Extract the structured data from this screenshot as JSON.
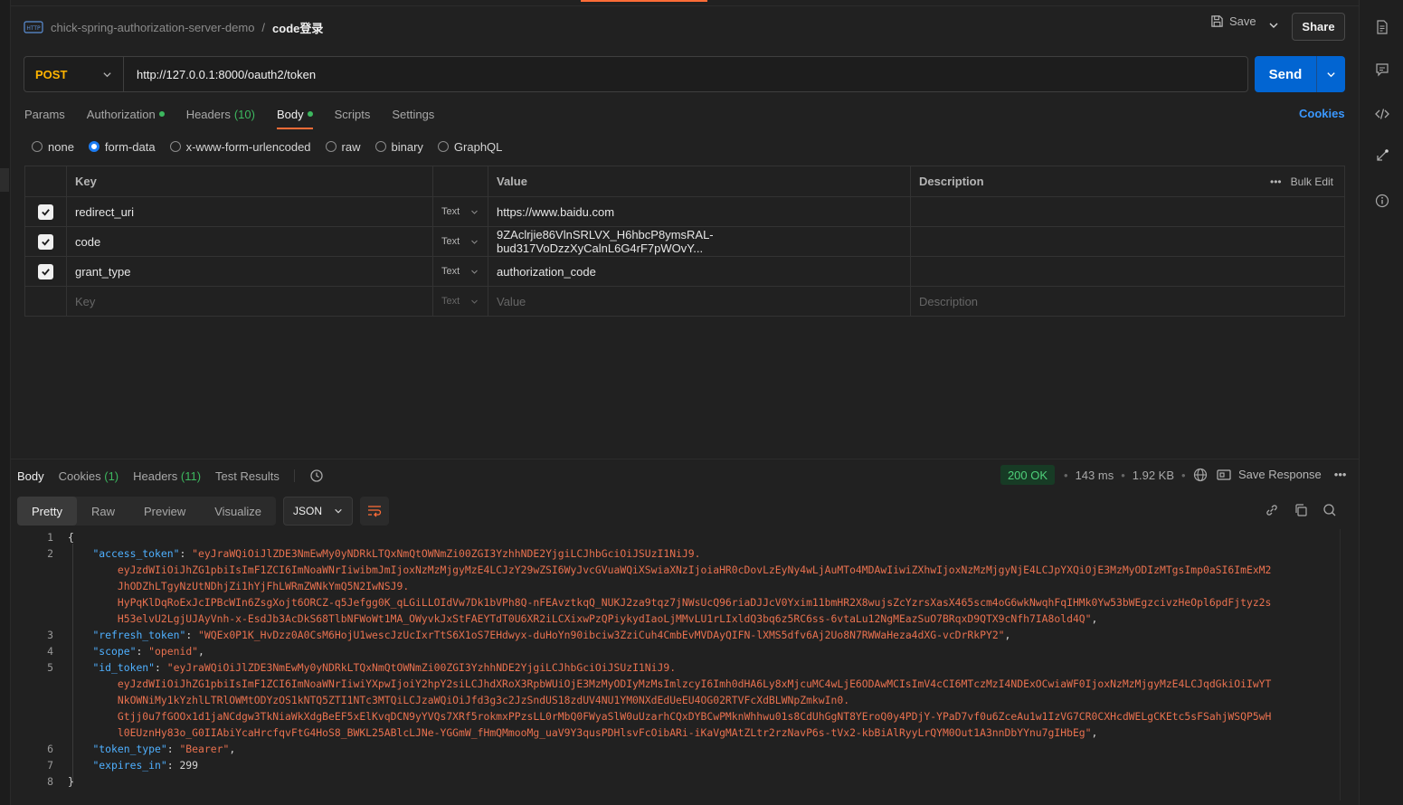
{
  "header": {
    "collection": "chick-spring-authorization-server-demo",
    "separator": "/",
    "request_name": "code登录",
    "save_label": "Save",
    "share_label": "Share"
  },
  "request": {
    "method": "POST",
    "url": "http://127.0.0.1:8000/oauth2/token",
    "send_label": "Send"
  },
  "req_tabs": {
    "params": "Params",
    "authorization": "Authorization",
    "headers": "Headers",
    "headers_count": "(10)",
    "body": "Body",
    "scripts": "Scripts",
    "settings": "Settings",
    "cookies": "Cookies"
  },
  "body_types": [
    "none",
    "form-data",
    "x-www-form-urlencoded",
    "raw",
    "binary",
    "GraphQL"
  ],
  "body_type_selected": "form-data",
  "form_table": {
    "headers": {
      "key": "Key",
      "value": "Value",
      "description": "Description",
      "bulk_edit": "Bulk Edit"
    },
    "rows": [
      {
        "key": "redirect_uri",
        "type": "Text",
        "value": "https://www.baidu.com",
        "checked": true
      },
      {
        "key": "code",
        "type": "Text",
        "value": "9ZAclrjie86VlnSRLVX_H6hbcP8ymsRAL-bud317VoDzzXyCalnL6G4rF7pWOvY...",
        "checked": true
      },
      {
        "key": "grant_type",
        "type": "Text",
        "value": "authorization_code",
        "checked": true
      }
    ],
    "placeholder": {
      "key": "Key",
      "type": "Text",
      "value": "Value",
      "description": "Description"
    }
  },
  "response": {
    "tabs": {
      "body": "Body",
      "cookies": "Cookies",
      "cookies_count": "(1)",
      "headers": "Headers",
      "headers_count": "(11)",
      "tests": "Test Results"
    },
    "status": "200 OK",
    "time": "143 ms",
    "size": "1.92 KB",
    "save_response": "Save Response",
    "view_tabs": [
      "Pretty",
      "Raw",
      "Preview",
      "Visualize"
    ],
    "format": "JSON",
    "lines": [
      {
        "n": "1",
        "parts": [
          [
            "p",
            "{"
          ]
        ]
      },
      {
        "n": "2",
        "parts": [
          [
            "p",
            "    "
          ],
          [
            "k",
            "\"access_token\""
          ],
          [
            "p",
            ": "
          ],
          [
            "s",
            "\"eyJraWQiOiJlZDE3NmEwMy0yNDRkLTQxNmQtOWNmZi00ZGI3YzhhNDE2YjgiLCJhbGciOiJSUzI1NiJ9."
          ]
        ]
      },
      {
        "n": "",
        "parts": [
          [
            "s",
            "        eyJzdWIiOiJhZG1pbiIsImF1ZCI6ImNoaWNrIiwibmJmIjoxNzMzMjgyMzE4LCJzY29wZSI6WyJvcGVuaWQiXSwiaXNzIjoiaHR0cDovLzEyNy4wLjAuMTo4MDAwIiwiZXhwIjoxNzMzMjgyNjE4LCJpYXQiOjE3MzMyODIzMTgsImp0aSI6ImExM2"
          ]
        ]
      },
      {
        "n": "",
        "parts": [
          [
            "s",
            "        JhODZhLTgyNzUtNDhjZi1hYjFhLWRmZWNkYmQ5N2IwNSJ9."
          ]
        ]
      },
      {
        "n": "",
        "parts": [
          [
            "s",
            "        HyPqKlDqRoExJcIPBcWIn6ZsgXojt6ORCZ-q5Jefgg0K_qLGiLLOIdVw7Dk1bVPh8Q-nFEAvztkqQ_NUKJ2za9tqz7jNWsUcQ96riaDJJcV0Yxim11bmHR2X8wujsZcYzrsXasX465scm4oG6wkNwqhFqIHMk0Yw53bWEgzcivzHeOpl6pdFjtyz2s"
          ]
        ]
      },
      {
        "n": "",
        "parts": [
          [
            "s",
            "        H53elvU2LgjUJAyVnh-x-EsdJb3AcDkS68TlbNFWoWt1MA_OWyvkJxStFAEYTdT0U6XR2iLCXixwPzQPiykydIaoLjMMvLU1rLIxldQ3bq6z5RC6ss-6vtaLu12NgMEazSuO7BRqxD9QTX9cNfh7IA8old4Q\""
          ],
          [
            "p",
            ","
          ]
        ]
      },
      {
        "n": "3",
        "parts": [
          [
            "p",
            "    "
          ],
          [
            "k",
            "\"refresh_token\""
          ],
          [
            "p",
            ": "
          ],
          [
            "s",
            "\"WQEx0P1K_HvDzz0A0CsM6HojU1wescJzUcIxrTtS6X1oS7EHdwyx-duHoYn90ibciw3ZziCuh4CmbEvMVDAyQIFN-lXMS5dfv6Aj2Uo8N7RWWaHeza4dXG-vcDrRkPY2\""
          ],
          [
            "p",
            ","
          ]
        ]
      },
      {
        "n": "4",
        "parts": [
          [
            "p",
            "    "
          ],
          [
            "k",
            "\"scope\""
          ],
          [
            "p",
            ": "
          ],
          [
            "s",
            "\"openid\""
          ],
          [
            "p",
            ","
          ]
        ]
      },
      {
        "n": "5",
        "parts": [
          [
            "p",
            "    "
          ],
          [
            "k",
            "\"id_token\""
          ],
          [
            "p",
            ": "
          ],
          [
            "s",
            "\"eyJraWQiOiJlZDE3NmEwMy0yNDRkLTQxNmQtOWNmZi00ZGI3YzhhNDE2YjgiLCJhbGciOiJSUzI1NiJ9."
          ]
        ]
      },
      {
        "n": "",
        "parts": [
          [
            "s",
            "        eyJzdWIiOiJhZG1pbiIsImF1ZCI6ImNoaWNrIiwiYXpwIjoiY2hpY2siLCJhdXRoX3RpbWUiOjE3MzMyODIyMzMsImlzcyI6Imh0dHA6Ly8xMjcuMC4wLjE6ODAwMCIsImV4cCI6MTczMzI4NDExOCwiaWF0IjoxNzMzMjgyMzE4LCJqdGkiOiIwYT"
          ]
        ]
      },
      {
        "n": "",
        "parts": [
          [
            "s",
            "        NkOWNiMy1kYzhlLTRlOWMtODYzOS1kNTQ5ZTI1NTc3MTQiLCJzaWQiOiJfd3g3c2JzSndUS18zdUV4NU1YM0NXdEdUeEU4OG02RTVFcXdBLWNpZmkwIn0."
          ]
        ]
      },
      {
        "n": "",
        "parts": [
          [
            "s",
            "        Gtjj0u7fGOOx1d1jaNCdgw3TkNiaWkXdgBeEF5xElKvqDCN9yYVQs7XRf5rokmxPPzsLL0rMbQ0FWyaSlW0uUzarhCQxDYBCwPMknWhhwu01s8CdUhGgNT8YEroQ0y4PDjY-YPaD7vf0u6ZceAu1w1IzVG7CR0CXHcdWELgCKEtc5sFSahjWSQP5wH"
          ]
        ]
      },
      {
        "n": "",
        "parts": [
          [
            "s",
            "        l0EUznHy83o_G0IIAbiYcaHrcfqvFtG4HoS8_BWKL25ABlcLJNe-YGGmW_fHmQMmooMg_uaV9Y3qusPDHlsvFcOibARi-iKaVgMAtZLtr2rzNavP6s-tVx2-kbBiAlRyyLrQYM0Out1A3nnDbYYnu7gIHbEg\""
          ],
          [
            "p",
            ","
          ]
        ]
      },
      {
        "n": "6",
        "parts": [
          [
            "p",
            "    "
          ],
          [
            "k",
            "\"token_type\""
          ],
          [
            "p",
            ": "
          ],
          [
            "s",
            "\"Bearer\""
          ],
          [
            "p",
            ","
          ]
        ]
      },
      {
        "n": "7",
        "parts": [
          [
            "p",
            "    "
          ],
          [
            "k",
            "\"expires_in\""
          ],
          [
            "p",
            ": "
          ],
          [
            "n",
            "299"
          ]
        ]
      },
      {
        "n": "8",
        "parts": [
          [
            "p",
            "}"
          ]
        ]
      }
    ]
  },
  "colors": {
    "accent": "#ff6c37",
    "send": "#0265d2",
    "status_ok": "#4ed07a",
    "json_key": "#4fb0ff",
    "json_string": "#e9714f",
    "method": "#ffb400"
  }
}
